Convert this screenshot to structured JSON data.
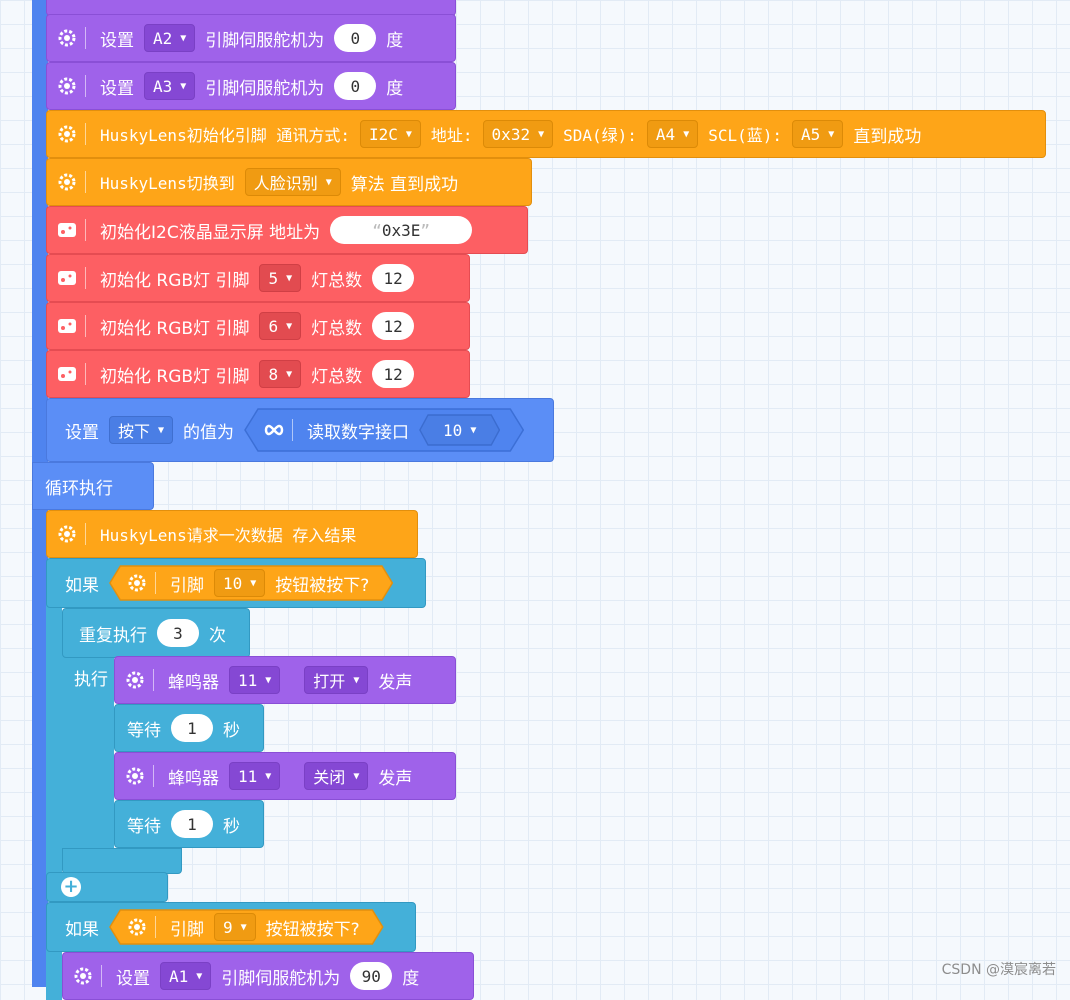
{
  "blocks": {
    "servo_a2": {
      "label": "设置",
      "pin": "A2",
      "text": "引脚伺服舵机为",
      "value": "0",
      "unit": "度"
    },
    "servo_a3": {
      "label": "设置",
      "pin": "A3",
      "text": "引脚伺服舵机为",
      "value": "0",
      "unit": "度"
    },
    "husky_init": {
      "label": "HuskyLens初始化引脚 通讯方式:",
      "comm": "I2C",
      "addr_label": "地址:",
      "addr": "0x32",
      "sda_label": "SDA(绿):",
      "sda": "A4",
      "scl_label": "SCL(蓝):",
      "scl": "A5",
      "suffix": "直到成功"
    },
    "husky_switch": {
      "label": "HuskyLens切换到",
      "algo": "人脸识别",
      "suffix": "算法 直到成功"
    },
    "lcd_init": {
      "label": "初始化I2C液晶显示屏 地址为",
      "addr": "0x3E"
    },
    "rgb1": {
      "label": "初始化 RGB灯 引脚",
      "pin": "5",
      "count_label": "灯总数",
      "count": "12"
    },
    "rgb2": {
      "label": "初始化 RGB灯 引脚",
      "pin": "6",
      "count_label": "灯总数",
      "count": "12"
    },
    "rgb3": {
      "label": "初始化 RGB灯 引脚",
      "pin": "8",
      "count_label": "灯总数",
      "count": "12"
    },
    "set_var": {
      "label": "设置",
      "var": "按下",
      "mid": "的值为",
      "read_label": "读取数字接口",
      "pin": "10"
    },
    "loop_label": "循环执行",
    "husky_request": {
      "label": "HuskyLens请求一次数据 存入结果"
    },
    "if1": {
      "label": "如果",
      "pin_label": "引脚",
      "pin": "10",
      "cond": "按钮被按下?"
    },
    "repeat": {
      "label": "重复执行",
      "count": "3",
      "unit": "次",
      "do_label": "执行"
    },
    "buzzer_on": {
      "label": "蜂鸣器",
      "pin": "11",
      "state": "打开",
      "suffix": "发声"
    },
    "wait1": {
      "label": "等待",
      "value": "1",
      "unit": "秒"
    },
    "buzzer_off": {
      "label": "蜂鸣器",
      "pin": "11",
      "state": "关闭",
      "suffix": "发声"
    },
    "wait2": {
      "label": "等待",
      "value": "1",
      "unit": "秒"
    },
    "if2": {
      "label": "如果",
      "pin_label": "引脚",
      "pin": "9",
      "cond": "按钮被按下?"
    },
    "servo_a1": {
      "label": "设置",
      "pin": "A1",
      "text": "引脚伺服舵机为",
      "value": "90",
      "unit": "度"
    }
  },
  "icons": {
    "gear": "gear-icon",
    "lcd": "lcd-icon",
    "loop": "infinity-icon",
    "add": "plus-icon"
  },
  "colors": {
    "servo": "#9f62ea",
    "husky": "#fea518",
    "display": "#fd5f63",
    "variable": "#5b8ef6",
    "control": "#44b0d9"
  },
  "watermark": "CSDN @漠宸离若"
}
